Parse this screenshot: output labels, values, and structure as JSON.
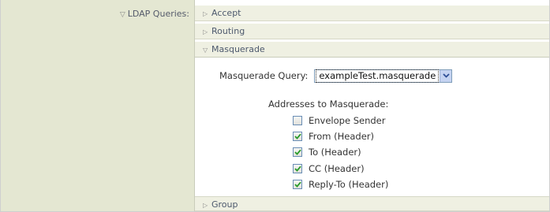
{
  "ldap": {
    "label": "LDAP Queries:",
    "sections": {
      "accept": "Accept",
      "routing": "Routing",
      "masquerade": "Masquerade",
      "group": "Group"
    }
  },
  "masquerade": {
    "query_label": "Masquerade Query:",
    "query_selected": "exampleTest.masquerade",
    "addresses_label": "Addresses to Masquerade:",
    "options": [
      {
        "label": "Envelope Sender",
        "checked": false
      },
      {
        "label": "From (Header)",
        "checked": true
      },
      {
        "label": "To (Header)",
        "checked": true
      },
      {
        "label": "CC (Header)",
        "checked": true
      },
      {
        "label": "Reply-To (Header)",
        "checked": true
      }
    ]
  },
  "icons": {
    "expanded": "triangle-down-icon",
    "collapsed": "triangle-right-icon",
    "dropdown": "chevron-down-icon",
    "check": "checkmark-icon"
  },
  "colors": {
    "label_bg": "#e4e7d2",
    "section_bg": "#eff0e2",
    "checkbox_border": "#6a8eb5",
    "check_mark": "#2a9c2a"
  }
}
